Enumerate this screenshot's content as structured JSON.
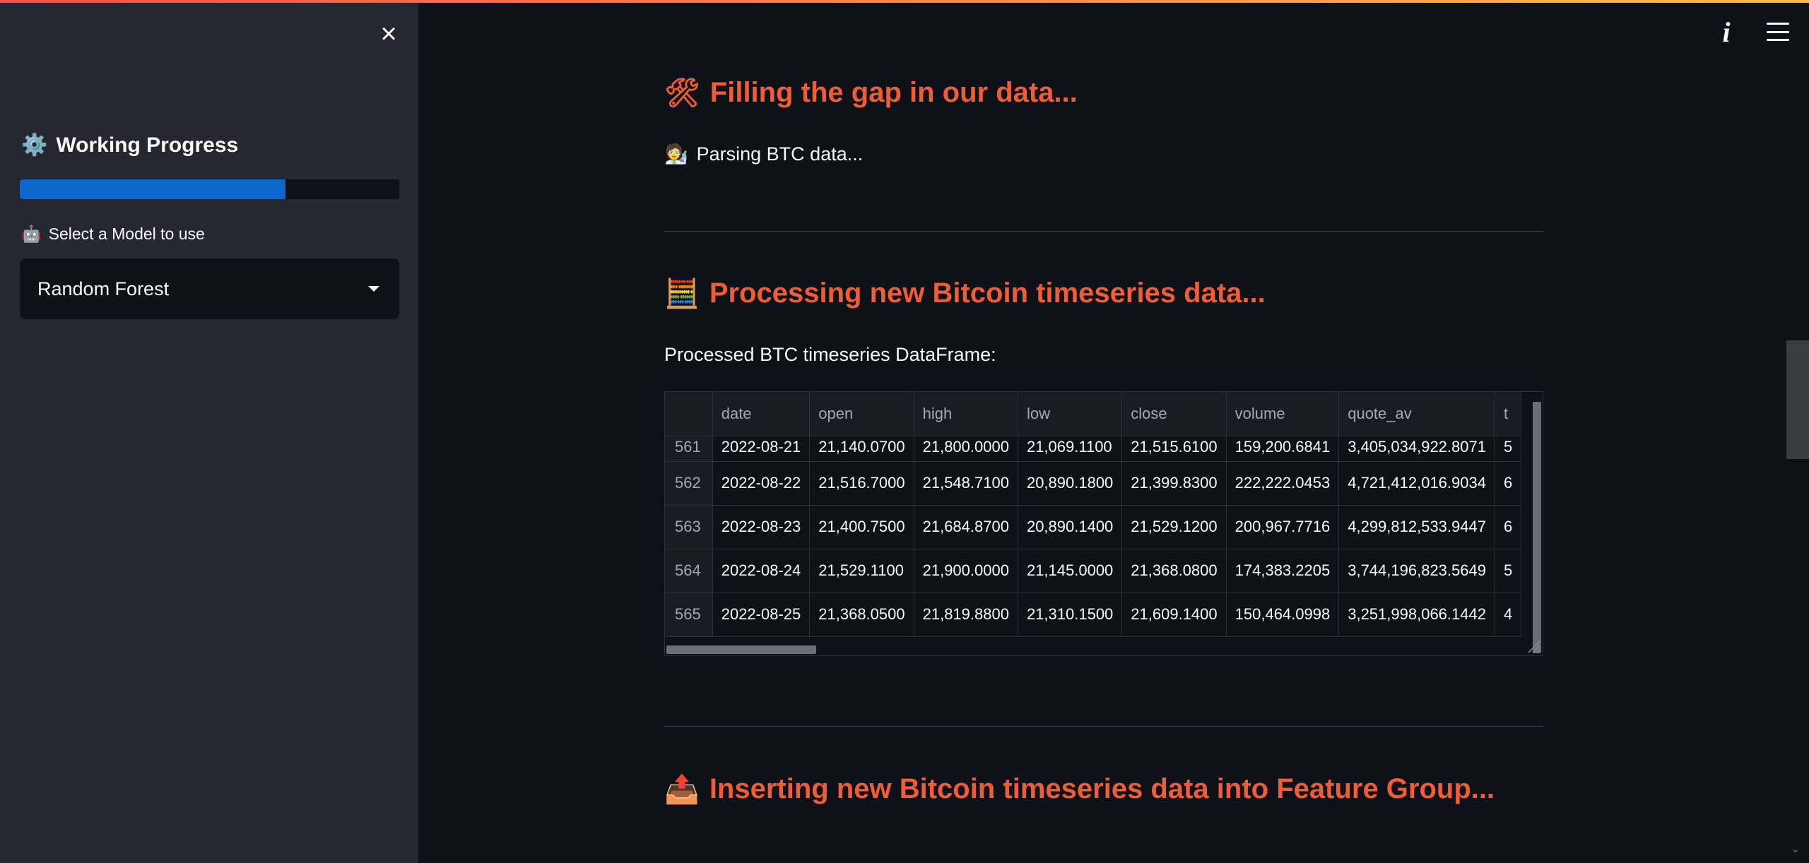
{
  "colors": {
    "accent": "#f05d34",
    "progress": "#0c66cc",
    "sidebar_bg": "#262730",
    "main_bg": "#0e1117"
  },
  "sidebar": {
    "close_icon": "close-icon",
    "title_emoji": "⚙️",
    "title": "Working Progress",
    "progress_fraction": 0.7,
    "select_label_emoji": "🤖",
    "select_label": "Select a Model to use",
    "select_value": "Random Forest"
  },
  "header": {
    "info_icon": "info-icon",
    "menu_icon": "hamburger-menu-icon"
  },
  "main": {
    "section1": {
      "emoji": "🛠",
      "title": "Filling the gap in our data...",
      "status_emoji": "🧑‍🔬",
      "status": "Parsing BTC data..."
    },
    "section2": {
      "emoji": "🧮",
      "title": "Processing new Bitcoin timeseries data...",
      "caption": "Processed BTC timeseries DataFrame:",
      "columns": [
        "",
        "date",
        "open",
        "high",
        "low",
        "close",
        "volume",
        "quote_av",
        "t"
      ],
      "rows": [
        [
          "561",
          "2022-08-21",
          "21,140.0700",
          "21,800.0000",
          "21,069.1100",
          "21,515.6100",
          "159,200.6841",
          "3,405,034,922.8071",
          "5"
        ],
        [
          "562",
          "2022-08-22",
          "21,516.7000",
          "21,548.7100",
          "20,890.1800",
          "21,399.8300",
          "222,222.0453",
          "4,721,412,016.9034",
          "6"
        ],
        [
          "563",
          "2022-08-23",
          "21,400.7500",
          "21,684.8700",
          "20,890.1400",
          "21,529.1200",
          "200,967.7716",
          "4,299,812,533.9447",
          "6"
        ],
        [
          "564",
          "2022-08-24",
          "21,529.1100",
          "21,900.0000",
          "21,145.0000",
          "21,368.0800",
          "174,383.2205",
          "3,744,196,823.5649",
          "5"
        ],
        [
          "565",
          "2022-08-25",
          "21,368.0500",
          "21,819.8800",
          "21,310.1500",
          "21,609.1400",
          "150,464.0998",
          "3,251,998,066.1442",
          "4"
        ]
      ]
    },
    "section3": {
      "emoji": "📤",
      "title": "Inserting new Bitcoin timeseries data into Feature Group..."
    }
  }
}
